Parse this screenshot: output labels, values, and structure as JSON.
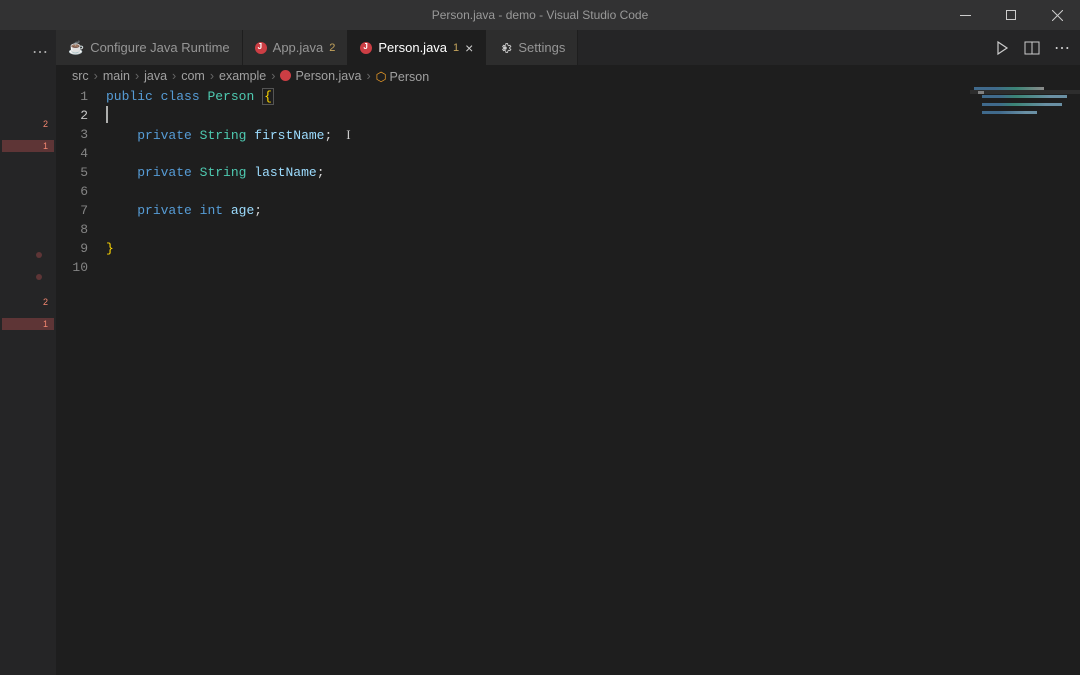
{
  "titlebar": {
    "title": "Person.java - demo - Visual Studio Code"
  },
  "tabs": {
    "configure": {
      "label": "Configure Java Runtime"
    },
    "app": {
      "label": "App.java",
      "badge": "2"
    },
    "person": {
      "label": "Person.java",
      "badge": "1"
    },
    "settings": {
      "label": "Settings"
    }
  },
  "breadcrumbs": {
    "items": [
      "src",
      "main",
      "java",
      "com",
      "example",
      "Person.java",
      "Person"
    ]
  },
  "gutter_markers": {
    "m1": "2",
    "m2": "1",
    "m3": "2",
    "m4": "1"
  },
  "editor": {
    "line_numbers": [
      "1",
      "2",
      "3",
      "4",
      "5",
      "6",
      "7",
      "8",
      "9",
      "10"
    ],
    "active_line": 2,
    "code": {
      "l1": {
        "kw1": "public",
        "kw2": "class",
        "name": "Person",
        "brace": "{"
      },
      "l3": {
        "kw": "private",
        "type": "String",
        "field": "firstName",
        "end": ";"
      },
      "l5": {
        "kw": "private",
        "type": "String",
        "field": "lastName",
        "end": ";"
      },
      "l7": {
        "kw": "private",
        "type": "int",
        "field": "age",
        "end": ";"
      },
      "l9": {
        "brace": "}"
      }
    }
  }
}
